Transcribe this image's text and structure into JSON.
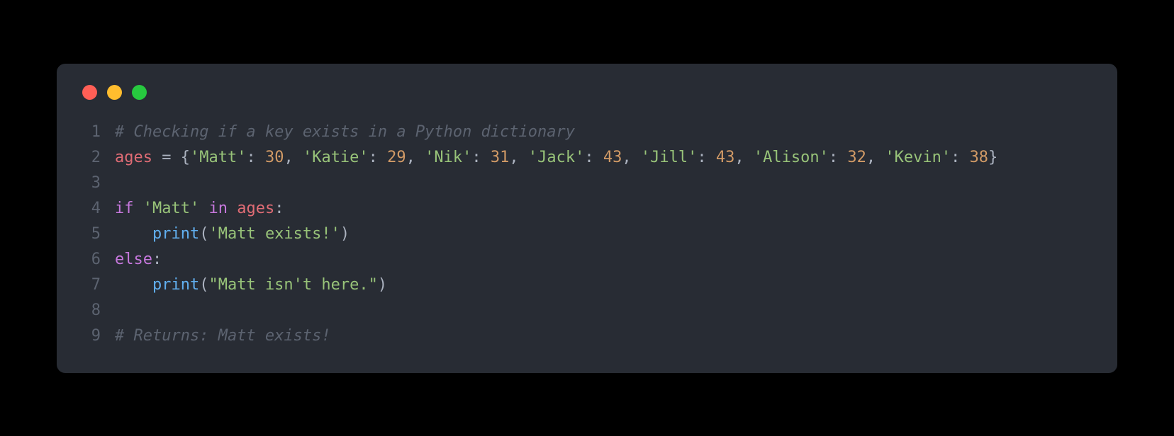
{
  "colors": {
    "background": "#000000",
    "window_bg": "#282c34",
    "gutter": "#5c6370",
    "text": "#abb2bf",
    "comment": "#5c6370",
    "identifier": "#e06c75",
    "string": "#98c379",
    "number": "#d19a66",
    "keyword": "#c678dd",
    "function": "#61afef",
    "traffic_red": "#ff5f56",
    "traffic_yellow": "#ffbd2e",
    "traffic_green": "#27c93f"
  },
  "lines": [
    {
      "n": "1",
      "tokens": [
        {
          "t": "# Checking if a key exists in a Python dictionary",
          "c": "tok-comment"
        }
      ]
    },
    {
      "n": "2",
      "tokens": [
        {
          "t": "ages",
          "c": "tok-ident"
        },
        {
          "t": " = {",
          "c": "tok-default"
        },
        {
          "t": "'Matt'",
          "c": "tok-str"
        },
        {
          "t": ": ",
          "c": "tok-default"
        },
        {
          "t": "30",
          "c": "tok-num"
        },
        {
          "t": ", ",
          "c": "tok-default"
        },
        {
          "t": "'Katie'",
          "c": "tok-str"
        },
        {
          "t": ": ",
          "c": "tok-default"
        },
        {
          "t": "29",
          "c": "tok-num"
        },
        {
          "t": ", ",
          "c": "tok-default"
        },
        {
          "t": "'Nik'",
          "c": "tok-str"
        },
        {
          "t": ": ",
          "c": "tok-default"
        },
        {
          "t": "31",
          "c": "tok-num"
        },
        {
          "t": ", ",
          "c": "tok-default"
        },
        {
          "t": "'Jack'",
          "c": "tok-str"
        },
        {
          "t": ": ",
          "c": "tok-default"
        },
        {
          "t": "43",
          "c": "tok-num"
        },
        {
          "t": ", ",
          "c": "tok-default"
        },
        {
          "t": "'Jill'",
          "c": "tok-str"
        },
        {
          "t": ": ",
          "c": "tok-default"
        },
        {
          "t": "43",
          "c": "tok-num"
        },
        {
          "t": ", ",
          "c": "tok-default"
        },
        {
          "t": "'Alison'",
          "c": "tok-str"
        },
        {
          "t": ": ",
          "c": "tok-default"
        },
        {
          "t": "32",
          "c": "tok-num"
        },
        {
          "t": ", ",
          "c": "tok-default"
        },
        {
          "t": "'Kevin'",
          "c": "tok-str"
        },
        {
          "t": ": ",
          "c": "tok-default"
        },
        {
          "t": "38",
          "c": "tok-num"
        },
        {
          "t": "}",
          "c": "tok-default"
        }
      ]
    },
    {
      "n": "3",
      "tokens": []
    },
    {
      "n": "4",
      "tokens": [
        {
          "t": "if",
          "c": "tok-kw"
        },
        {
          "t": " ",
          "c": "tok-default"
        },
        {
          "t": "'Matt'",
          "c": "tok-str"
        },
        {
          "t": " ",
          "c": "tok-default"
        },
        {
          "t": "in",
          "c": "tok-kwop"
        },
        {
          "t": " ",
          "c": "tok-default"
        },
        {
          "t": "ages",
          "c": "tok-ident"
        },
        {
          "t": ":",
          "c": "tok-default"
        }
      ]
    },
    {
      "n": "5",
      "tokens": [
        {
          "t": "    ",
          "c": "tok-default"
        },
        {
          "t": "print",
          "c": "tok-fn"
        },
        {
          "t": "(",
          "c": "tok-default"
        },
        {
          "t": "'Matt exists!'",
          "c": "tok-str"
        },
        {
          "t": ")",
          "c": "tok-default"
        }
      ]
    },
    {
      "n": "6",
      "tokens": [
        {
          "t": "else",
          "c": "tok-kw"
        },
        {
          "t": ":",
          "c": "tok-default"
        }
      ]
    },
    {
      "n": "7",
      "tokens": [
        {
          "t": "    ",
          "c": "tok-default"
        },
        {
          "t": "print",
          "c": "tok-fn"
        },
        {
          "t": "(",
          "c": "tok-default"
        },
        {
          "t": "\"Matt isn't here.\"",
          "c": "tok-str"
        },
        {
          "t": ")",
          "c": "tok-default"
        }
      ]
    },
    {
      "n": "8",
      "tokens": []
    },
    {
      "n": "9",
      "tokens": [
        {
          "t": "# Returns: Matt exists!",
          "c": "tok-comment"
        }
      ]
    }
  ]
}
